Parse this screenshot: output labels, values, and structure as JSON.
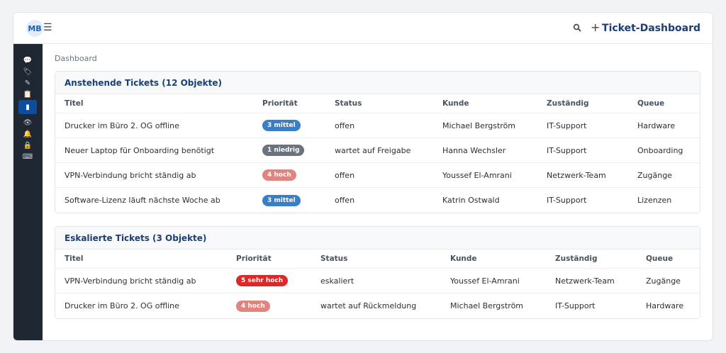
{
  "header": {
    "avatar_initials": "MB",
    "app_title": "Ticket-Dashboard",
    "menu_icon": "hamburger-menu-icon",
    "search_icon": "search-icon",
    "add_icon": "plus-icon"
  },
  "sidebar": {
    "items": [
      {
        "icon": "chat-icon",
        "glyph": "💬",
        "active": false
      },
      {
        "icon": "tag-icon",
        "glyph": "🏷",
        "active": false
      },
      {
        "icon": "pencil-icon",
        "glyph": "✎",
        "active": false
      },
      {
        "icon": "clipboard-icon",
        "glyph": "📋",
        "active": false
      },
      {
        "icon": "ticket-icon",
        "glyph": "▮",
        "active": true
      },
      {
        "icon": "eye-icon",
        "glyph": "👁",
        "active": false
      },
      {
        "icon": "bell-icon",
        "glyph": "🔔",
        "active": false
      },
      {
        "icon": "lock-icon",
        "glyph": "🔒",
        "active": false
      },
      {
        "icon": "keyboard-icon",
        "glyph": "⌨",
        "active": false
      }
    ]
  },
  "breadcrumb": "Dashboard",
  "colors": {
    "accent": "#1a3f73",
    "priority_medium": "#3b7ec8",
    "priority_low": "#6c737d",
    "priority_high": "#e2837f",
    "priority_very_high": "#dc2828"
  },
  "pending": {
    "title": "Anstehende Tickets (12 Objekte)",
    "columns": [
      "Titel",
      "Priorität",
      "Status",
      "Kunde",
      "Zuständig",
      "Queue"
    ],
    "rows": [
      {
        "titel": "Drucker im Büro 2. OG offline",
        "prio": "3 mittel",
        "prio_color": "#3b7ec8",
        "status": "offen",
        "kunde": "Michael Bergström",
        "zustaendig": "IT-Support",
        "queue": "Hardware"
      },
      {
        "titel": "Neuer Laptop für Onboarding benötigt",
        "prio": "1 niedrig",
        "prio_color": "#6c737d",
        "status": "wartet auf Freigabe",
        "kunde": "Hanna Wechsler",
        "zustaendig": "IT-Support",
        "queue": "Onboarding"
      },
      {
        "titel": "VPN-Verbindung bricht ständig ab",
        "prio": "4 hoch",
        "prio_color": "#e2837f",
        "status": "offen",
        "kunde": "Youssef El-Amrani",
        "zustaendig": "Netzwerk-Team",
        "queue": "Zugänge"
      },
      {
        "titel": "Software-Lizenz läuft nächste Woche ab",
        "prio": "3 mittel",
        "prio_color": "#3b7ec8",
        "status": "offen",
        "kunde": "Katrin Ostwald",
        "zustaendig": "IT-Support",
        "queue": "Lizenzen"
      }
    ]
  },
  "escalated": {
    "title": "Eskalierte Tickets (3 Objekte)",
    "columns": [
      "Titel",
      "Priorität",
      "Status",
      "Kunde",
      "Zuständig",
      "Queue"
    ],
    "rows": [
      {
        "titel": "VPN-Verbindung bricht ständig ab",
        "prio": "5 sehr hoch",
        "prio_color": "#dc2828",
        "status": "eskaliert",
        "kunde": "Youssef El-Amrani",
        "zustaendig": "Netzwerk-Team",
        "queue": "Zugänge"
      },
      {
        "titel": "Drucker im Büro 2. OG offline",
        "prio": "4 hoch",
        "prio_color": "#e2837f",
        "status": "wartet auf Rückmeldung",
        "kunde": "Michael Bergström",
        "zustaendig": "IT-Support",
        "queue": "Hardware"
      }
    ]
  }
}
